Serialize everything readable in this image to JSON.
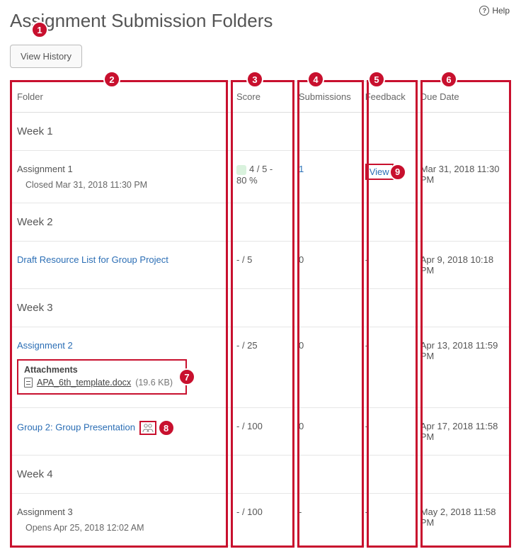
{
  "help": {
    "label": "Help"
  },
  "page_title": "Assignment Submission Folders",
  "view_history_label": "View History",
  "headers": {
    "folder": "Folder",
    "score": "Score",
    "submissions": "Submissions",
    "feedback": "Feedback",
    "due": "Due Date"
  },
  "categories": [
    {
      "name": "Week 1",
      "rows": [
        {
          "folder_text": "Assignment 1",
          "folder_is_link": false,
          "sub_text": "Closed Mar 31, 2018 11:30 PM",
          "score_line1": "4 / 5 -",
          "score_line2": "80 %",
          "score_has_pill": true,
          "submissions": "1",
          "submissions_is_link": true,
          "feedback": "View",
          "feedback_box": true,
          "due": "Mar 31, 2018 11:30 PM"
        }
      ]
    },
    {
      "name": "Week 2",
      "rows": [
        {
          "folder_text": "Draft Resource List for Group Project",
          "folder_is_link": true,
          "score_line1": "- / 5",
          "submissions": "0",
          "feedback": "-",
          "due": "Apr 9, 2018 10:18 PM"
        }
      ]
    },
    {
      "name": "Week 3",
      "rows": [
        {
          "folder_text": "Assignment 2",
          "folder_is_link": true,
          "attachments": {
            "title": "Attachments",
            "file_name": "APA_6th_template.docx",
            "file_size": "(19.6 KB)"
          },
          "score_line1": "- / 25",
          "submissions": "0",
          "feedback": "-",
          "due": "Apr 13, 2018 11:59 PM"
        },
        {
          "folder_text": "Group 2: Group Presentation",
          "folder_is_link": true,
          "group_icon": true,
          "score_line1": "- / 100",
          "submissions": "0",
          "feedback": "-",
          "due": "Apr 17, 2018 11:58 PM"
        }
      ]
    },
    {
      "name": "Week 4",
      "rows": [
        {
          "folder_text": "Assignment 3",
          "folder_is_link": false,
          "sub_text": "Opens Apr 25, 2018 12:02 AM",
          "score_line1": "- / 100",
          "submissions": "-",
          "feedback": "-",
          "due": "May 2, 2018 11:58 PM"
        }
      ]
    }
  ],
  "badges": [
    "1",
    "2",
    "3",
    "4",
    "5",
    "6",
    "7",
    "8",
    "9"
  ]
}
